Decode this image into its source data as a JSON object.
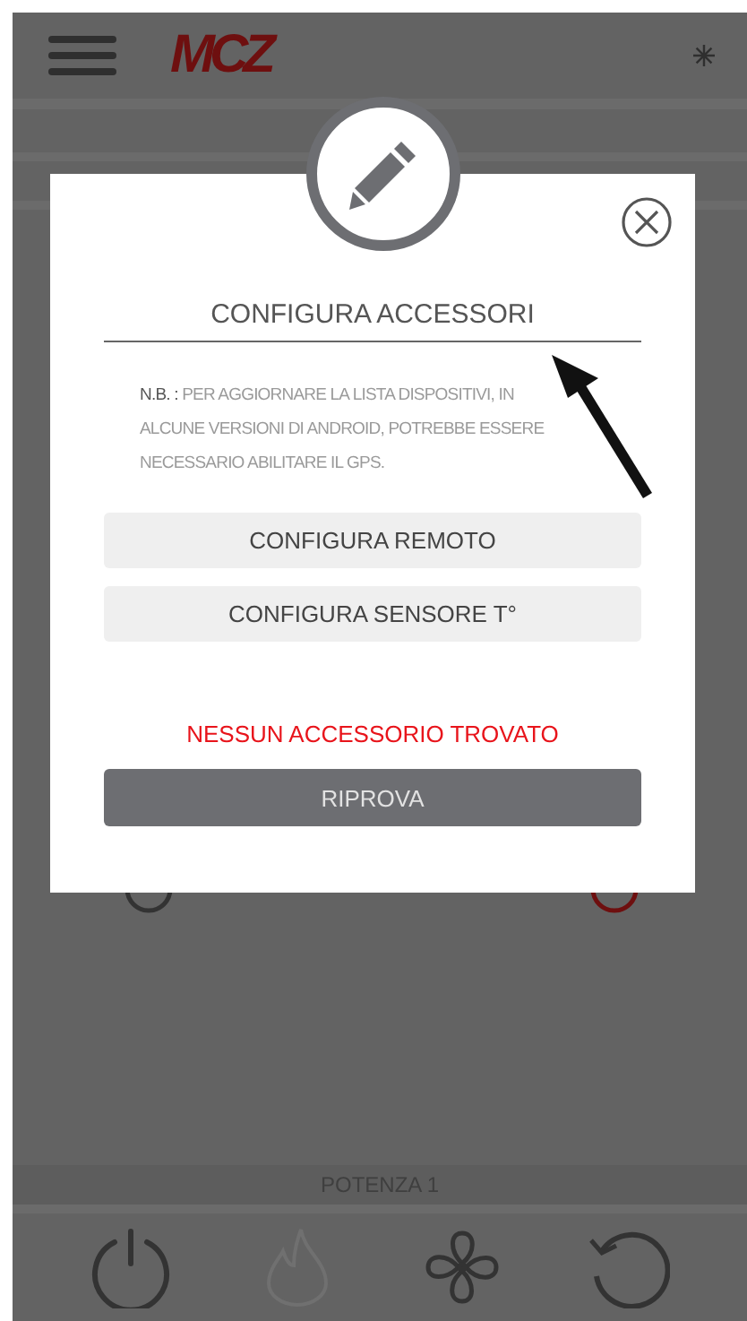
{
  "header": {
    "logo": "MCZ"
  },
  "dialog": {
    "title": "CONFIGURA ACCESSORI",
    "note": "**N.B. :** PER AGGIORNARE LA LISTA DISPOSITIVI, IN ALCUNE VERSIONI DI ANDROID, POTREBBE ESSERE NECESSARIO ABILITARE IL GPS.",
    "buttons": [
      "CONFIGURA REMOTO",
      "CONFIGURA SENSORE T°"
    ],
    "status": "NESSUN ACCESSORIO TROVATO",
    "retry": "RIPROVA"
  },
  "footer": {
    "label": "POTENZA 1",
    "controls": [
      {
        "kind": "power",
        "disabled": false
      },
      {
        "kind": "flame",
        "disabled": true
      },
      {
        "kind": "fan",
        "disabled": false
      },
      {
        "kind": "reset",
        "disabled": false
      }
    ]
  }
}
